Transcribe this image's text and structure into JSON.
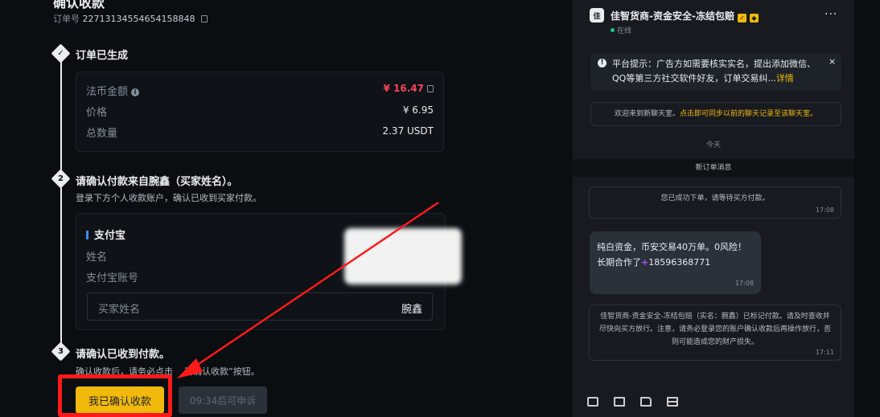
{
  "order": {
    "title": "确认收款",
    "order_no_label": "订单号",
    "order_no": "22713134554654158848"
  },
  "step1": {
    "number": "",
    "title": "订单已生成",
    "fiat_label": "法币金额",
    "fiat_value": "¥ 16.47",
    "price_label": "价格",
    "price_value": "¥ 6.95",
    "qty_label": "总数量",
    "qty_value": "2.37 USDT"
  },
  "step2": {
    "number": "2",
    "title": "请确认付款来自腕鑫（买家姓名）。",
    "desc": "登录下方个人收款账户，确认已收到买家付款。",
    "method": "支付宝",
    "name_label": "姓名",
    "account_label": "支付宝账号",
    "buyer_label": "买家姓名",
    "buyer_value": "腕鑫"
  },
  "step3": {
    "number": "3",
    "title": "请确认已收到付款。",
    "desc_a": "确认收款后，请务必点击",
    "desc_b": "已确认收款”按钮。",
    "confirm_label": "我已确认收款",
    "appeal_label": "09:34后可申诉"
  },
  "chat": {
    "avatar_text": "佳",
    "name": "佳智货商-资金安全-冻结包赔",
    "status": "在线",
    "more": "···",
    "notice_prefix": "平台提示：",
    "notice_text": "广告方如需要核实实名，提出添加微信、QQ等第三方社交软件好友，订单交易纠...",
    "notice_link": "详情",
    "notice_close": "×",
    "welcome_a": "欢迎来到新聊天室。",
    "welcome_b": "点击即可同步以前的聊天记录至该聊天室。",
    "today": "今天",
    "new_order": "新订单消息",
    "msg1": "您已成功下单，请等待买方付款。",
    "msg1_time": "17:08",
    "bubble_line1": "纯白资金，币安交易40万单。0风险！",
    "bubble_line2_a": "长期合作了",
    "bubble_plus": "+",
    "bubble_line2_b": "18596368771",
    "bubble_time": "17:08",
    "msg2": "佳智货商-资金安全-冻结包赔（实名：腕鑫）已标记付款。请及时查收并尽快向买方放行。注意，请务必登录您的账户确认收款后再操作放行，否则可能造成您的财产损失。",
    "msg2_time": "17:11"
  },
  "colors": {
    "accent": "#f0b90b",
    "fiat_red": "#f6465d",
    "highlight_red": "#ff1a1a",
    "background": "#0b0e11",
    "chat_bg": "#181a20"
  },
  "icons": [
    "copy-icon",
    "info-icon",
    "more-icon",
    "close-icon",
    "chat-icon",
    "image-icon",
    "file-icon",
    "card-icon"
  ]
}
